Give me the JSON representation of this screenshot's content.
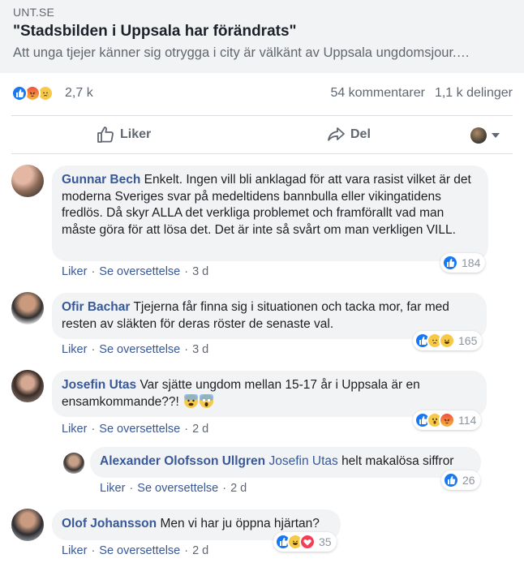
{
  "link_preview": {
    "domain": "UNT.SE",
    "title": "\"Stadsbilden i Uppsala har förändrats\"",
    "description": "Att unga tjejer känner sig otrygga i city är välkänt av Uppsala ungdomsjour.…"
  },
  "summary": {
    "reaction_icons": [
      "like-icon",
      "angry-icon",
      "sad-icon"
    ],
    "reaction_count": "2,7 k",
    "comments": "54 kommentarer",
    "shares": "1,1 k delinger"
  },
  "actions": {
    "like_label": "Liker",
    "share_label": "Del"
  },
  "comments": [
    {
      "author": "Gunnar Bech",
      "text": "Enkelt. Ingen vill bli anklagad för att vara rasist vilket är det moderna Sveriges svar på medeltidens bannbulla eller vikingatidens fredlös. Då skyr ALLA det verkliga problemet och framförallt vad man måste göra för att lösa det. Det är inte så svårt om man verkligen VILL.",
      "like": "Liker",
      "translate": "Se oversettelse",
      "time": "3 d",
      "reaction_icons": [
        "like-icon"
      ],
      "reaction_count": "184"
    },
    {
      "author": "Ofir Bachar",
      "text": "Tjejerna får finna sig i situationen och tacka mor, far med resten av släkten för deras röster de senaste val.",
      "like": "Liker",
      "translate": "Se oversettelse",
      "time": "3 d",
      "reaction_icons": [
        "like-icon",
        "sad-icon",
        "haha-icon"
      ],
      "reaction_count": "165"
    },
    {
      "author": "Josefin Utas",
      "text": "Var sjätte ungdom mellan 15-17 år i Uppsala är en ensamkommande??!",
      "text_emojis": [
        "fearful-face-icon",
        "screaming-face-icon"
      ],
      "like": "Liker",
      "translate": "Se oversettelse",
      "time": "2 d",
      "reaction_icons": [
        "like-icon",
        "wow-icon",
        "angry-icon"
      ],
      "reaction_count": "114"
    },
    {
      "author": "Alexander Olofsson Ullgren",
      "tag": "Josefin Utas",
      "text": "helt makalösa siffror",
      "like": "Liker",
      "translate": "Se oversettelse",
      "time": "2 d",
      "reaction_icons": [
        "like-icon"
      ],
      "reaction_count": "26"
    },
    {
      "author": "Olof Johansson",
      "text": "Men vi har ju öppna hjärtan?",
      "like": "Liker",
      "translate": "Se oversettelse",
      "time": "2 d",
      "reaction_icons": [
        "like-icon",
        "haha-icon",
        "love-icon"
      ],
      "reaction_count": "35"
    }
  ],
  "colors": {
    "link": "#385898",
    "meta": "#606770",
    "bubble": "#f2f3f5",
    "like_blue": "#1877f2"
  }
}
